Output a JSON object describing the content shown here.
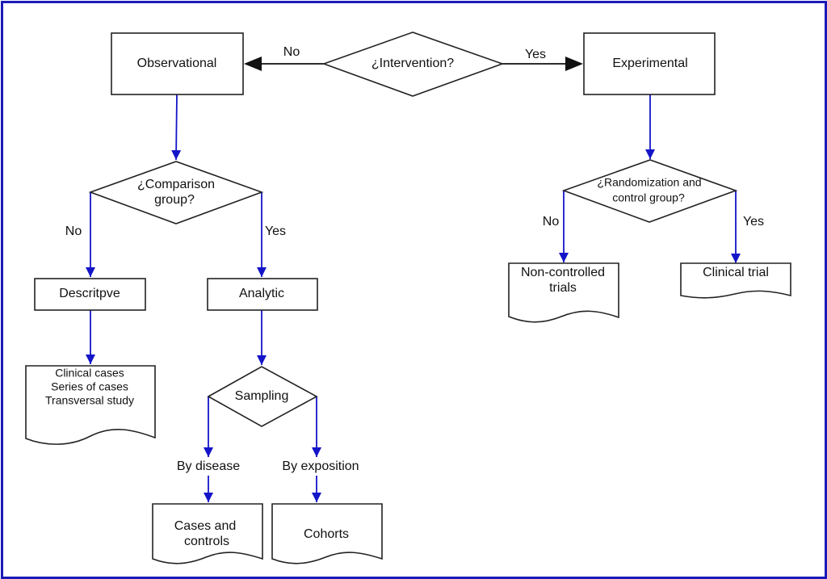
{
  "diagram": {
    "colors": {
      "frame": "#1a1ab8",
      "blue_edge": "#1414c8",
      "black_edge": "#111111",
      "shape_stroke": "#222222"
    },
    "nodes": {
      "intervention": {
        "type": "decision",
        "lines": [
          "¿Intervention?"
        ]
      },
      "observational": {
        "type": "process",
        "lines": [
          "Observational"
        ]
      },
      "experimental": {
        "type": "process",
        "lines": [
          "Experimental"
        ]
      },
      "comparison": {
        "type": "decision",
        "lines": [
          "¿Comparison",
          "group?"
        ]
      },
      "randomization": {
        "type": "decision",
        "lines": [
          "¿Randomization and",
          "control group?"
        ]
      },
      "descriptive": {
        "type": "process",
        "lines": [
          "Descritpve"
        ]
      },
      "analytic": {
        "type": "process",
        "lines": [
          "Analytic"
        ]
      },
      "descriptive_docs": {
        "type": "document",
        "lines": [
          "Clinical cases",
          "Series of cases",
          "Transversal study"
        ]
      },
      "sampling": {
        "type": "decision",
        "lines": [
          "Sampling"
        ]
      },
      "cases_controls": {
        "type": "document",
        "lines": [
          "Cases and",
          "controls"
        ]
      },
      "cohorts": {
        "type": "document",
        "lines": [
          "Cohorts"
        ]
      },
      "non_controlled": {
        "type": "document",
        "lines": [
          "Non-controlled",
          "trials"
        ]
      },
      "clinical_trial": {
        "type": "document",
        "lines": [
          "Clinical trial"
        ]
      }
    },
    "edges": [
      {
        "from": "intervention",
        "to": "observational",
        "label": "No"
      },
      {
        "from": "intervention",
        "to": "experimental",
        "label": "Yes"
      },
      {
        "from": "observational",
        "to": "comparison",
        "label": ""
      },
      {
        "from": "experimental",
        "to": "randomization",
        "label": ""
      },
      {
        "from": "comparison",
        "to": "descriptive",
        "label": "No"
      },
      {
        "from": "comparison",
        "to": "analytic",
        "label": "Yes"
      },
      {
        "from": "randomization",
        "to": "non_controlled",
        "label": "No"
      },
      {
        "from": "randomization",
        "to": "clinical_trial",
        "label": "Yes"
      },
      {
        "from": "descriptive",
        "to": "descriptive_docs",
        "label": ""
      },
      {
        "from": "analytic",
        "to": "sampling",
        "label": ""
      },
      {
        "from": "sampling",
        "to": "cases_controls",
        "label": "By disease"
      },
      {
        "from": "sampling",
        "to": "cohorts",
        "label": "By exposition"
      }
    ]
  }
}
